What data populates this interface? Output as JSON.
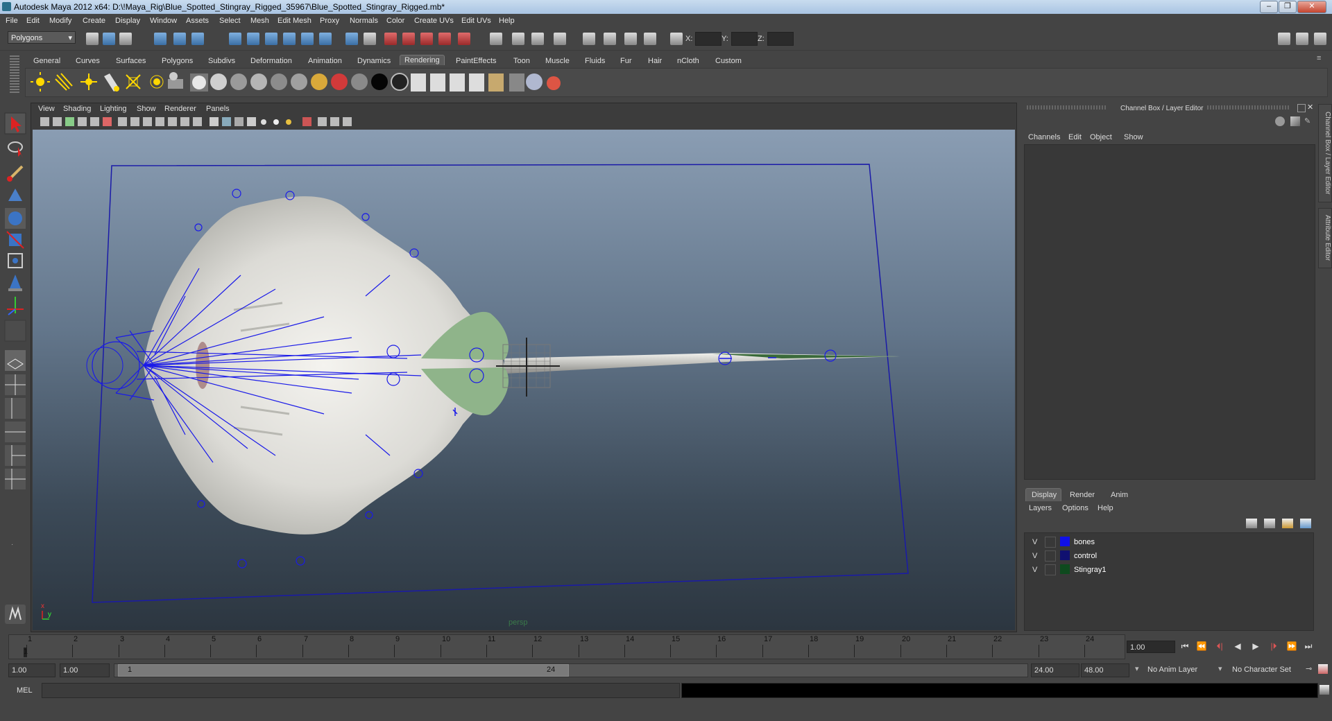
{
  "window": {
    "title": "Autodesk Maya 2012 x64: D:\\!Maya_Rig\\Blue_Spotted_Stingray_Rigged_35967\\Blue_Spotted_Stingray_Rigged.mb*",
    "controls": [
      "–",
      "❐",
      "✕"
    ]
  },
  "menubar": [
    "File",
    "Edit",
    "Modify",
    "Create",
    "Display",
    "Window",
    "Assets",
    "Select",
    "Mesh",
    "Edit Mesh",
    "Proxy",
    "Normals",
    "Color",
    "Create UVs",
    "Edit UVs",
    "Help"
  ],
  "statusline": {
    "mode": "Polygons",
    "x_label": "X:",
    "y_label": "Y:",
    "z_label": "Z:"
  },
  "shelf": {
    "tabs": [
      "General",
      "Curves",
      "Surfaces",
      "Polygons",
      "Subdivs",
      "Deformation",
      "Animation",
      "Dynamics",
      "Rendering",
      "PaintEffects",
      "Toon",
      "Muscle",
      "Fluids",
      "Fur",
      "Hair",
      "nCloth",
      "Custom"
    ],
    "active_tab": "Rendering"
  },
  "viewport": {
    "menus": [
      "View",
      "Shading",
      "Lighting",
      "Show",
      "Renderer",
      "Panels"
    ],
    "camera_label": "persp",
    "axis_x": "x",
    "axis_y": "y"
  },
  "channel_box": {
    "title": "Channel Box / Layer Editor",
    "menus": [
      "Channels",
      "Edit",
      "Object",
      "Show"
    ],
    "side_tabs": [
      "Channel Box / Layer Editor",
      "Attribute Editor"
    ]
  },
  "layer_editor": {
    "tabs": [
      "Display",
      "Render",
      "Anim"
    ],
    "active_tab": "Display",
    "menus": [
      "Layers",
      "Options",
      "Help"
    ],
    "layers": [
      {
        "visible": "V",
        "name": "bones",
        "color": "#1010e8"
      },
      {
        "visible": "V",
        "name": "control",
        "color": "#101070"
      },
      {
        "visible": "V",
        "name": "Stingray1",
        "color": "#0e4a1e"
      }
    ]
  },
  "timeslider": {
    "ticks": [
      "1",
      "2",
      "3",
      "4",
      "5",
      "6",
      "7",
      "8",
      "9",
      "10",
      "11",
      "12",
      "13",
      "14",
      "15",
      "16",
      "17",
      "18",
      "19",
      "20",
      "21",
      "22",
      "23",
      "24"
    ],
    "current_frame_label": "1",
    "current_time": "1.00",
    "playback": [
      "⏮",
      "⏪",
      "⏴|",
      "◀",
      "▶",
      "|⏵",
      "⏩",
      "⏭"
    ]
  },
  "range": {
    "start": "1.00",
    "playback_start": "1.00",
    "range_start_label": "1",
    "range_end_label": "24",
    "playback_end": "24.00",
    "end": "48.00",
    "anim_layer": "No Anim Layer",
    "character_set": "No Character Set"
  },
  "commandline": {
    "label": "MEL"
  }
}
